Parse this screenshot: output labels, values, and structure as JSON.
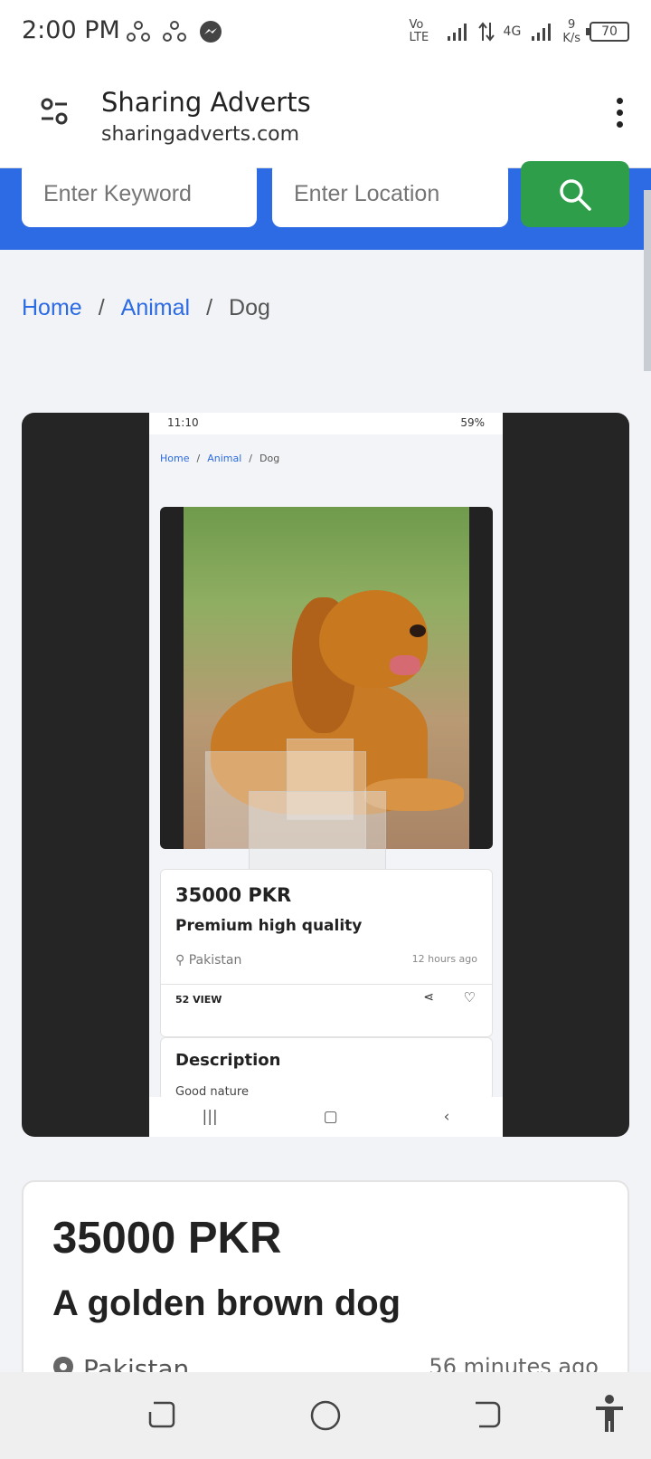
{
  "status_bar": {
    "time": "2:00 PM",
    "network_left": "Vo LTE",
    "network_right": "4G",
    "speed_value": "9",
    "speed_unit": "K/s",
    "battery": "70"
  },
  "browser": {
    "site_title": "Sharing Adverts",
    "site_url": "sharingadverts.com"
  },
  "search": {
    "keyword_placeholder": "Enter Keyword",
    "location_placeholder": "Enter Location"
  },
  "breadcrumb": {
    "home": "Home",
    "category": "Animal",
    "current": "Dog"
  },
  "listing_image": {
    "inner_time": "11:10",
    "inner_battery": "59%",
    "inner_crumb_home": "Home",
    "inner_crumb_category": "Animal",
    "inner_crumb_current": "Dog",
    "inner_price": "35000 PKR",
    "inner_title": "Premium high quality",
    "inner_location": "Pakistan",
    "inner_time_ago": "12 hours ago",
    "inner_views": "52 VIEW",
    "inner_desc_title": "Description",
    "inner_desc_text": "Good nature"
  },
  "listing": {
    "price": "35000 PKR",
    "title": "A golden brown dog",
    "location": "Pakistan",
    "time_ago": "56 minutes ago"
  },
  "colors": {
    "accent_blue": "#2c6be3",
    "search_green": "#2e9e4a"
  }
}
